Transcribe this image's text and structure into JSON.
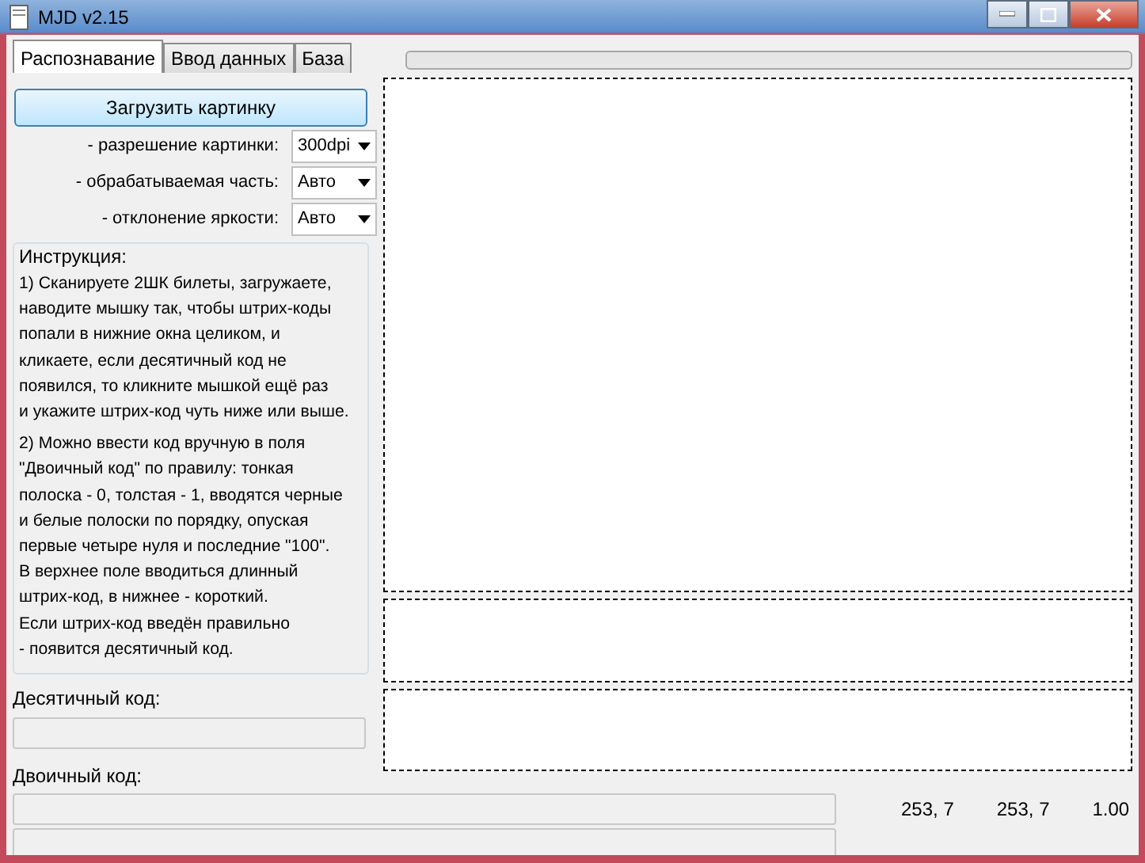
{
  "window": {
    "title": "MJD v2.15"
  },
  "tabs": [
    {
      "label": "Распознавание",
      "selected": true
    },
    {
      "label": "Ввод данных",
      "selected": false
    },
    {
      "label": "База",
      "selected": false
    }
  ],
  "progress": {
    "level": 0
  },
  "load_button": "Загрузить картинку",
  "settings": [
    {
      "label": "- разрешение картинки:",
      "value": "300dpi"
    },
    {
      "label": "- обрабатываемая часть:",
      "value": "Авто"
    },
    {
      "label": "- отклонение яркости:",
      "value": "Авто"
    }
  ],
  "instruction": {
    "title": "Инструкция:",
    "paragraphs": [
      "1) Сканируете 2ШК билеты, загружаете,\nнаводите мышку так, чтобы штрих-коды\nпопали в нижние окна целиком, и\nкликаете, если десятичный код не\nпоявился, то кликните мышкой ещё раз\nи укажите штрих-код чуть ниже или выше.",
      "2) Можно ввести код вручную в поля\n\"Двоичный код\" по правилу: тонкая\nполоска - 0, толстая - 1, вводятся черные\nи белые полоски по порядку, опуская\nпервые четыре нуля и последние \"100\".\nВ верхнее поле вводиться длинный\nштрих-код, в нижнее - короткий.\nЕсли штрих-код введён правильно\n- появится десятичный код."
    ]
  },
  "decimal_code": {
    "label": "Десятичный код:"
  },
  "binary_code": {
    "label": "Двоичный код:"
  },
  "readings": [
    "253, 7",
    "253, 7",
    "1.00"
  ]
}
